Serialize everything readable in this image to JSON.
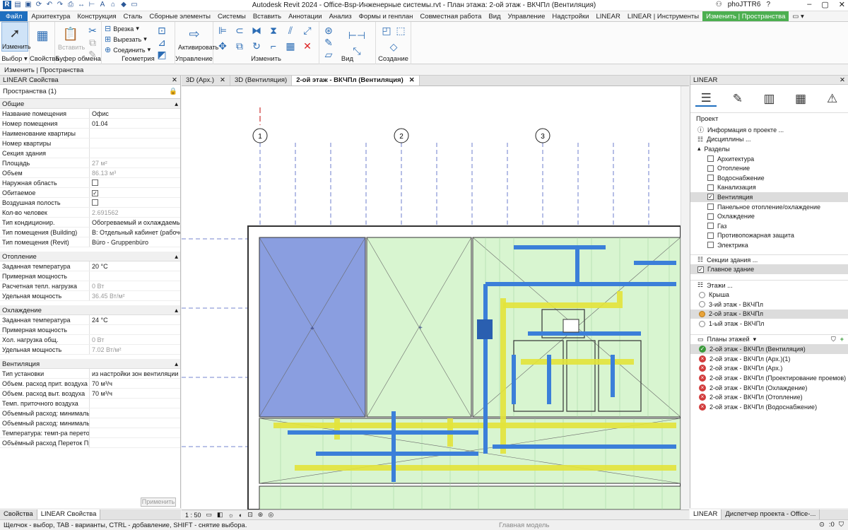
{
  "window": {
    "title": "Autodesk Revit 2024 - Office-Bsp-Инженерные системы.rvt - План этажа: 2-ой этаж - ВКЧПл (Вентиляция)",
    "user": "phoJTTR6",
    "qat_icons": [
      "revit-logo",
      "open-icon",
      "save-icon",
      "sync-icon",
      "undo-icon",
      "redo-icon",
      "print-icon",
      "measure-icon",
      "dimension-icon",
      "text-icon",
      "3d-icon",
      "section-icon",
      "close-views-icon"
    ]
  },
  "menu": {
    "tabs": [
      "Файл",
      "Архитектура",
      "Конструкция",
      "Сталь",
      "Сборные элементы",
      "Системы",
      "Вставить",
      "Аннотации",
      "Анализ",
      "Формы и генплан",
      "Совместная работа",
      "Вид",
      "Управление",
      "Надстройки",
      "LINEAR",
      "LINEAR | Инструменты",
      "Изменить | Пространства"
    ]
  },
  "ribbon": {
    "modify_label": "Изменить",
    "select_label": "Выбор ▾",
    "properties_label": "Свойства",
    "clipboard_label": "Буфер обмена",
    "paste_label": "Вставить",
    "cut_label": "Врезка",
    "cut2_label": "Вырезать",
    "join_label": "Соединить",
    "geometry_label": "Геометрия",
    "activate_label": "Активировать",
    "manage_label": "Управление",
    "edit_label": "Изменить",
    "view_label": "Вид",
    "create_label": "Создание"
  },
  "options_bar": "Изменить | Пространства",
  "properties": {
    "panel_title": "LINEAR Свойства",
    "type_selector": "Пространства (1)",
    "apply_button": "Применить",
    "groups": [
      {
        "name": "Общие",
        "rows": [
          {
            "k": "Название помещения",
            "v": "Офис"
          },
          {
            "k": "Номер помещения",
            "v": "01.04"
          },
          {
            "k": "Наименование квартиры",
            "v": ""
          },
          {
            "k": "Номер квартиры",
            "v": ""
          },
          {
            "k": "Секция здания",
            "v": ""
          },
          {
            "k": "Площадь",
            "v": "27 м²",
            "ro": true
          },
          {
            "k": "Объем",
            "v": "86.13 м³",
            "ro": true
          },
          {
            "k": "Наружная область",
            "v": "",
            "cb": "unchecked"
          },
          {
            "k": "Обитаемое",
            "v": "",
            "cb": "checked"
          },
          {
            "k": "Воздушная полость",
            "v": "",
            "cb": "unchecked"
          },
          {
            "k": "Кол-во человек",
            "v": "2.691562",
            "ro": true
          },
          {
            "k": "Тип кондиционир.",
            "v": "Обогреваемый и охлаждаемый"
          },
          {
            "k": "Тип помещения (Building)",
            "v": "B: Отдельный кабинет (рабоче"
          },
          {
            "k": "Тип помещения (Revit)",
            "v": "Büro - Gruppenbüro"
          }
        ]
      },
      {
        "name": "Отопление",
        "rows": [
          {
            "k": "Заданная температура",
            "v": "20 °C"
          },
          {
            "k": "Примерная мощность",
            "v": ""
          },
          {
            "k": "Расчетная тепл. нагрузка",
            "v": "0 Вт",
            "ro": true
          },
          {
            "k": "Удельная мощность",
            "v": "36.45 Вт/м²",
            "ro": true
          }
        ]
      },
      {
        "name": "Охлаждение",
        "rows": [
          {
            "k": "Заданная температура",
            "v": "24 °C"
          },
          {
            "k": "Примерная мощность",
            "v": ""
          },
          {
            "k": "Хол. нагрузка общ.",
            "v": "0 Вт",
            "ro": true
          },
          {
            "k": "Удельная мощность",
            "v": "7.02 Вт/м²",
            "ro": true
          }
        ]
      },
      {
        "name": "Вентиляция",
        "rows": [
          {
            "k": "Тип установки",
            "v": "из настройки зон вентиляции"
          },
          {
            "k": "Объем. расход прит. воздуха",
            "v": "70 м³/ч"
          },
          {
            "k": "Объем. расход выт. воздуха",
            "v": "70 м³/ч"
          },
          {
            "k": "Темп. приточного воздуха",
            "v": ""
          },
          {
            "k": "Объемный расход: минимальный с",
            "v": ""
          },
          {
            "k": "Объемный расход: минимальный к",
            "v": ""
          },
          {
            "k": "Температура: темп-ра перетока пр",
            "v": ""
          },
          {
            "k": "Объёмный расход Переток Прит. в",
            "v": ""
          }
        ]
      }
    ]
  },
  "view_tabs": [
    {
      "label": "3D (Арх.)",
      "active": false
    },
    {
      "label": "3D (Вентиляция)",
      "active": false
    },
    {
      "label": "2-ой этаж - ВКЧПл (Вентиляция)",
      "active": true
    }
  ],
  "grid_labels": [
    "1",
    "2",
    "3"
  ],
  "right_panel": {
    "title": "LINEAR",
    "project_label": "Проект",
    "project_info": "Информация о проекте ...",
    "disciplines": "Дисциплины ...",
    "sections_label": "Разделы",
    "sections": [
      {
        "label": "Архитектура",
        "checked": false
      },
      {
        "label": "Отопление",
        "checked": false
      },
      {
        "label": "Водоснабжение",
        "checked": false
      },
      {
        "label": "Канализация",
        "checked": false
      },
      {
        "label": "Вентиляция",
        "checked": true
      },
      {
        "label": "Панельное отопление/охлаждение",
        "checked": false
      },
      {
        "label": "Охлаждение",
        "checked": false
      },
      {
        "label": "Газ",
        "checked": false
      },
      {
        "label": "Противопожарная защита",
        "checked": false
      },
      {
        "label": "Электрика",
        "checked": false
      }
    ],
    "building_sections": "Секции здания ...",
    "main_building": "Главное здание",
    "levels_label": "Этажи ...",
    "levels": [
      {
        "label": "Крыша",
        "current": false
      },
      {
        "label": "3-ий этаж - ВКЧПл",
        "current": false
      },
      {
        "label": "2-ой этаж - ВКЧПл",
        "current": true
      },
      {
        "label": "1-ый этаж - ВКЧПл",
        "current": false
      }
    ],
    "plans_label": "Планы этажей",
    "plans": [
      {
        "label": "2-ой этаж - ВКЧПл (Вентиляция)",
        "status": "ok"
      },
      {
        "label": "2-ой этаж - ВКЧПл (Арх.)(1)",
        "status": "err"
      },
      {
        "label": "2-ой этаж - ВКЧПл (Арх.)",
        "status": "err"
      },
      {
        "label": "2-ой этаж - ВКЧПл (Проектирование проемов)",
        "status": "err"
      },
      {
        "label": "2-ой этаж - ВКЧПл (Охлаждение)",
        "status": "err"
      },
      {
        "label": "2-ой этаж - ВКЧПл (Отопление)",
        "status": "err"
      },
      {
        "label": "2-ой этаж - ВКЧПл (Водоснабжение)",
        "status": "err"
      }
    ]
  },
  "bottom": {
    "left_tabs": [
      "Свойства",
      "LINEAR Свойства"
    ],
    "scale": "1 : 50",
    "right_tabs": [
      "LINEAR",
      "Диспетчер проекта - Office-..."
    ],
    "status_text": "Щелчок - выбор, TAB - варианты, CTRL - добавление, SHIFT - снятие выбора.",
    "model_label": "Главная модель",
    "zero": ":0"
  },
  "colors": {
    "file_tab": "#1f6fbf",
    "context_tab": "#4caf50",
    "space_blue": "#8a9ee0",
    "space_green": "#d8f5d0",
    "duct_blue": "#3b7fd9",
    "duct_yellow": "#e6e638"
  }
}
